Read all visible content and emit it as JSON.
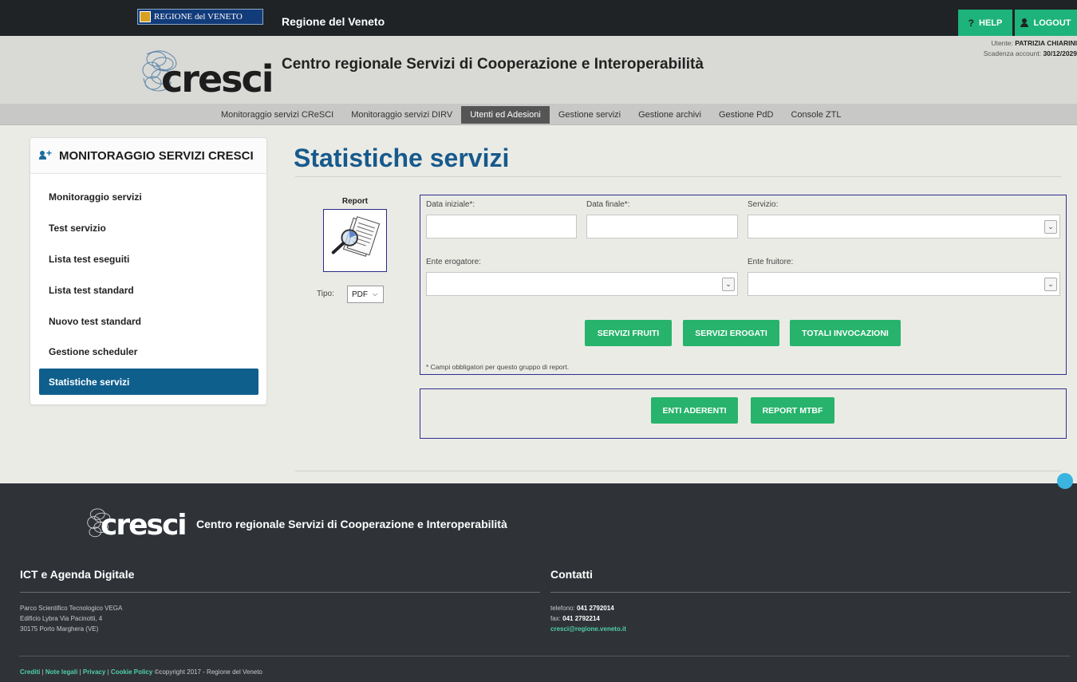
{
  "topbar": {
    "regione_logo": "REGIONE del VENETO",
    "title": "Regione del Veneto",
    "help_label": "HELP",
    "logout_label": "LOGOUT"
  },
  "header": {
    "logo_text": "cresci",
    "title": "Centro regionale Servizi di Cooperazione e Interoperabilità",
    "user_label": "Utente:",
    "user_name": "PATRIZIA CHIARINI",
    "expiry_label": "Scadenza account:",
    "expiry_value": "30/12/2029"
  },
  "nav": {
    "items": [
      "Monitoraggio servizi CReSCI",
      "Monitoraggio servizi DIRV",
      "Utenti ed Adesioni",
      "Gestione servizi",
      "Gestione archivi",
      "Gestione PdD",
      "Console ZTL"
    ],
    "active": "Utenti ed Adesioni"
  },
  "sidebar": {
    "title": "MONITORAGGIO SERVIZI CRESCI",
    "items": [
      "Monitoraggio servizi",
      "Test servizio",
      "Lista test eseguiti",
      "Lista test standard",
      "Nuovo test standard",
      "Gestione scheduler",
      "Statistiche servizi"
    ],
    "active": "Statistiche servizi"
  },
  "main": {
    "title": "Statistiche servizi",
    "report_label": "Report",
    "tipo_label": "Tipo:",
    "tipo_value": "PDF",
    "form": {
      "data_iniziale_label": "Data iniziale*:",
      "data_finale_label": "Data finale*:",
      "servizio_label": "Servizio:",
      "ente_erogatore_label": "Ente erogatore:",
      "ente_fruitore_label": "Ente fruitore:",
      "btn_servizi_fruiti": "SERVIZI FRUITI",
      "btn_servizi_erogati": "SERVIZI EROGATI",
      "btn_totali_invocazioni": "TOTALI INVOCAZIONI",
      "note": "* Campi obbligatori per questo gruppo di report."
    },
    "box2": {
      "btn_enti_aderenti": "ENTI ADERENTI",
      "btn_report_mtbf": "REPORT MTBF"
    }
  },
  "footer": {
    "logo_text": "cresci",
    "title": "Centro regionale Servizi di Cooperazione e Interoperabilità",
    "col1_title": "ICT e Agenda Digitale",
    "col1_lines": [
      "Parco Scientifico Tecnologico VEGA",
      "Edificio Lybra Via Pacinotti, 4",
      "30175 Porto Marghera (VE)"
    ],
    "col2_title": "Contatti",
    "telefono_label": "telefono:",
    "telefono": "041 2792014",
    "fax_label": "fax:",
    "fax": "041 2792214",
    "email": "cresci@regione.veneto.it",
    "links": [
      "Crediti",
      "Note legali",
      "Privacy",
      "Cookie Policy"
    ],
    "copyright": "©copyright 2017 - Regione del Veneto"
  },
  "colors": {
    "topbar": "#1f2326",
    "accent_green": "#27b36b",
    "title_blue": "#175a8c",
    "sidebar_active": "#0f5f8d",
    "footer": "#2f3338"
  }
}
